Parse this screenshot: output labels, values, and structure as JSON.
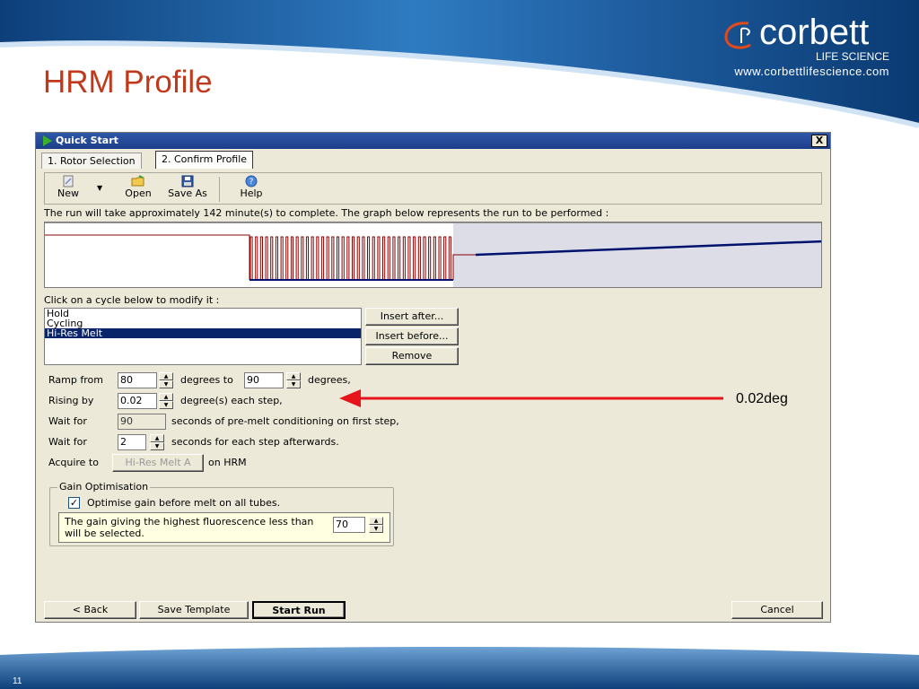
{
  "slide": {
    "title": "HRM Profile",
    "logo": {
      "brand": "corbett",
      "subtitle": "LIFE SCIENCE",
      "url": "www.corbettlifescience.com"
    },
    "page_number": "11",
    "annotation": "0.02deg",
    "colors": {
      "title": "#c0391a",
      "band": "#1a5fa0",
      "arrow": "#e8141c"
    }
  },
  "window": {
    "title": "Quick Start",
    "close_glyph": "X",
    "tabs": [
      {
        "label": "1. Rotor Selection",
        "active": false
      },
      {
        "label": "2. Confirm Profile",
        "active": true
      }
    ],
    "toolbar": {
      "new_label": "New",
      "open_label": "Open",
      "save_as_label": "Save As",
      "help_label": "Help"
    },
    "run_info": "The run will take approximately 142 minute(s) to complete. The graph below represents the run to be performed :",
    "click_label": "Click on a cycle below to modify it :",
    "cycles": [
      {
        "label": "Hold",
        "selected": false
      },
      {
        "label": "Cycling",
        "selected": false
      },
      {
        "label": "Hi-Res Melt",
        "selected": true
      }
    ],
    "buttons": {
      "insert_after": "Insert after...",
      "insert_before": "Insert before...",
      "remove": "Remove"
    },
    "settings": {
      "ramp_from_label": "Ramp from",
      "ramp_from_value": "80",
      "degrees_to_label": "degrees to",
      "ramp_to_value": "90",
      "degrees_label": "degrees,",
      "rising_by_label": "Rising by",
      "rising_by_value": "0.02",
      "each_step_label": "degree(s) each step,",
      "wait_for_label": "Wait for",
      "premelt_value": "90",
      "premelt_label": "seconds of pre-melt conditioning on first step,",
      "wait_for_label_2": "Wait for",
      "step_wait_value": "2",
      "step_wait_label": "seconds for each step afterwards.",
      "acquire_to_label": "Acquire to",
      "acquire_value": "Hi-Res Melt A",
      "on_hrm_label": "on HRM"
    },
    "gain": {
      "legend": "Gain Optimisation",
      "checkbox_label": "Optimise gain before melt on all tubes.",
      "checked": true,
      "note_line1": "The gain giving the highest fluorescence less than",
      "note_line2": "will be selected.",
      "threshold_value": "70"
    },
    "footer": {
      "back_label": "< Back",
      "save_template_label": "Save Template",
      "start_run_label": "Start Run",
      "cancel_label": "Cancel"
    }
  }
}
